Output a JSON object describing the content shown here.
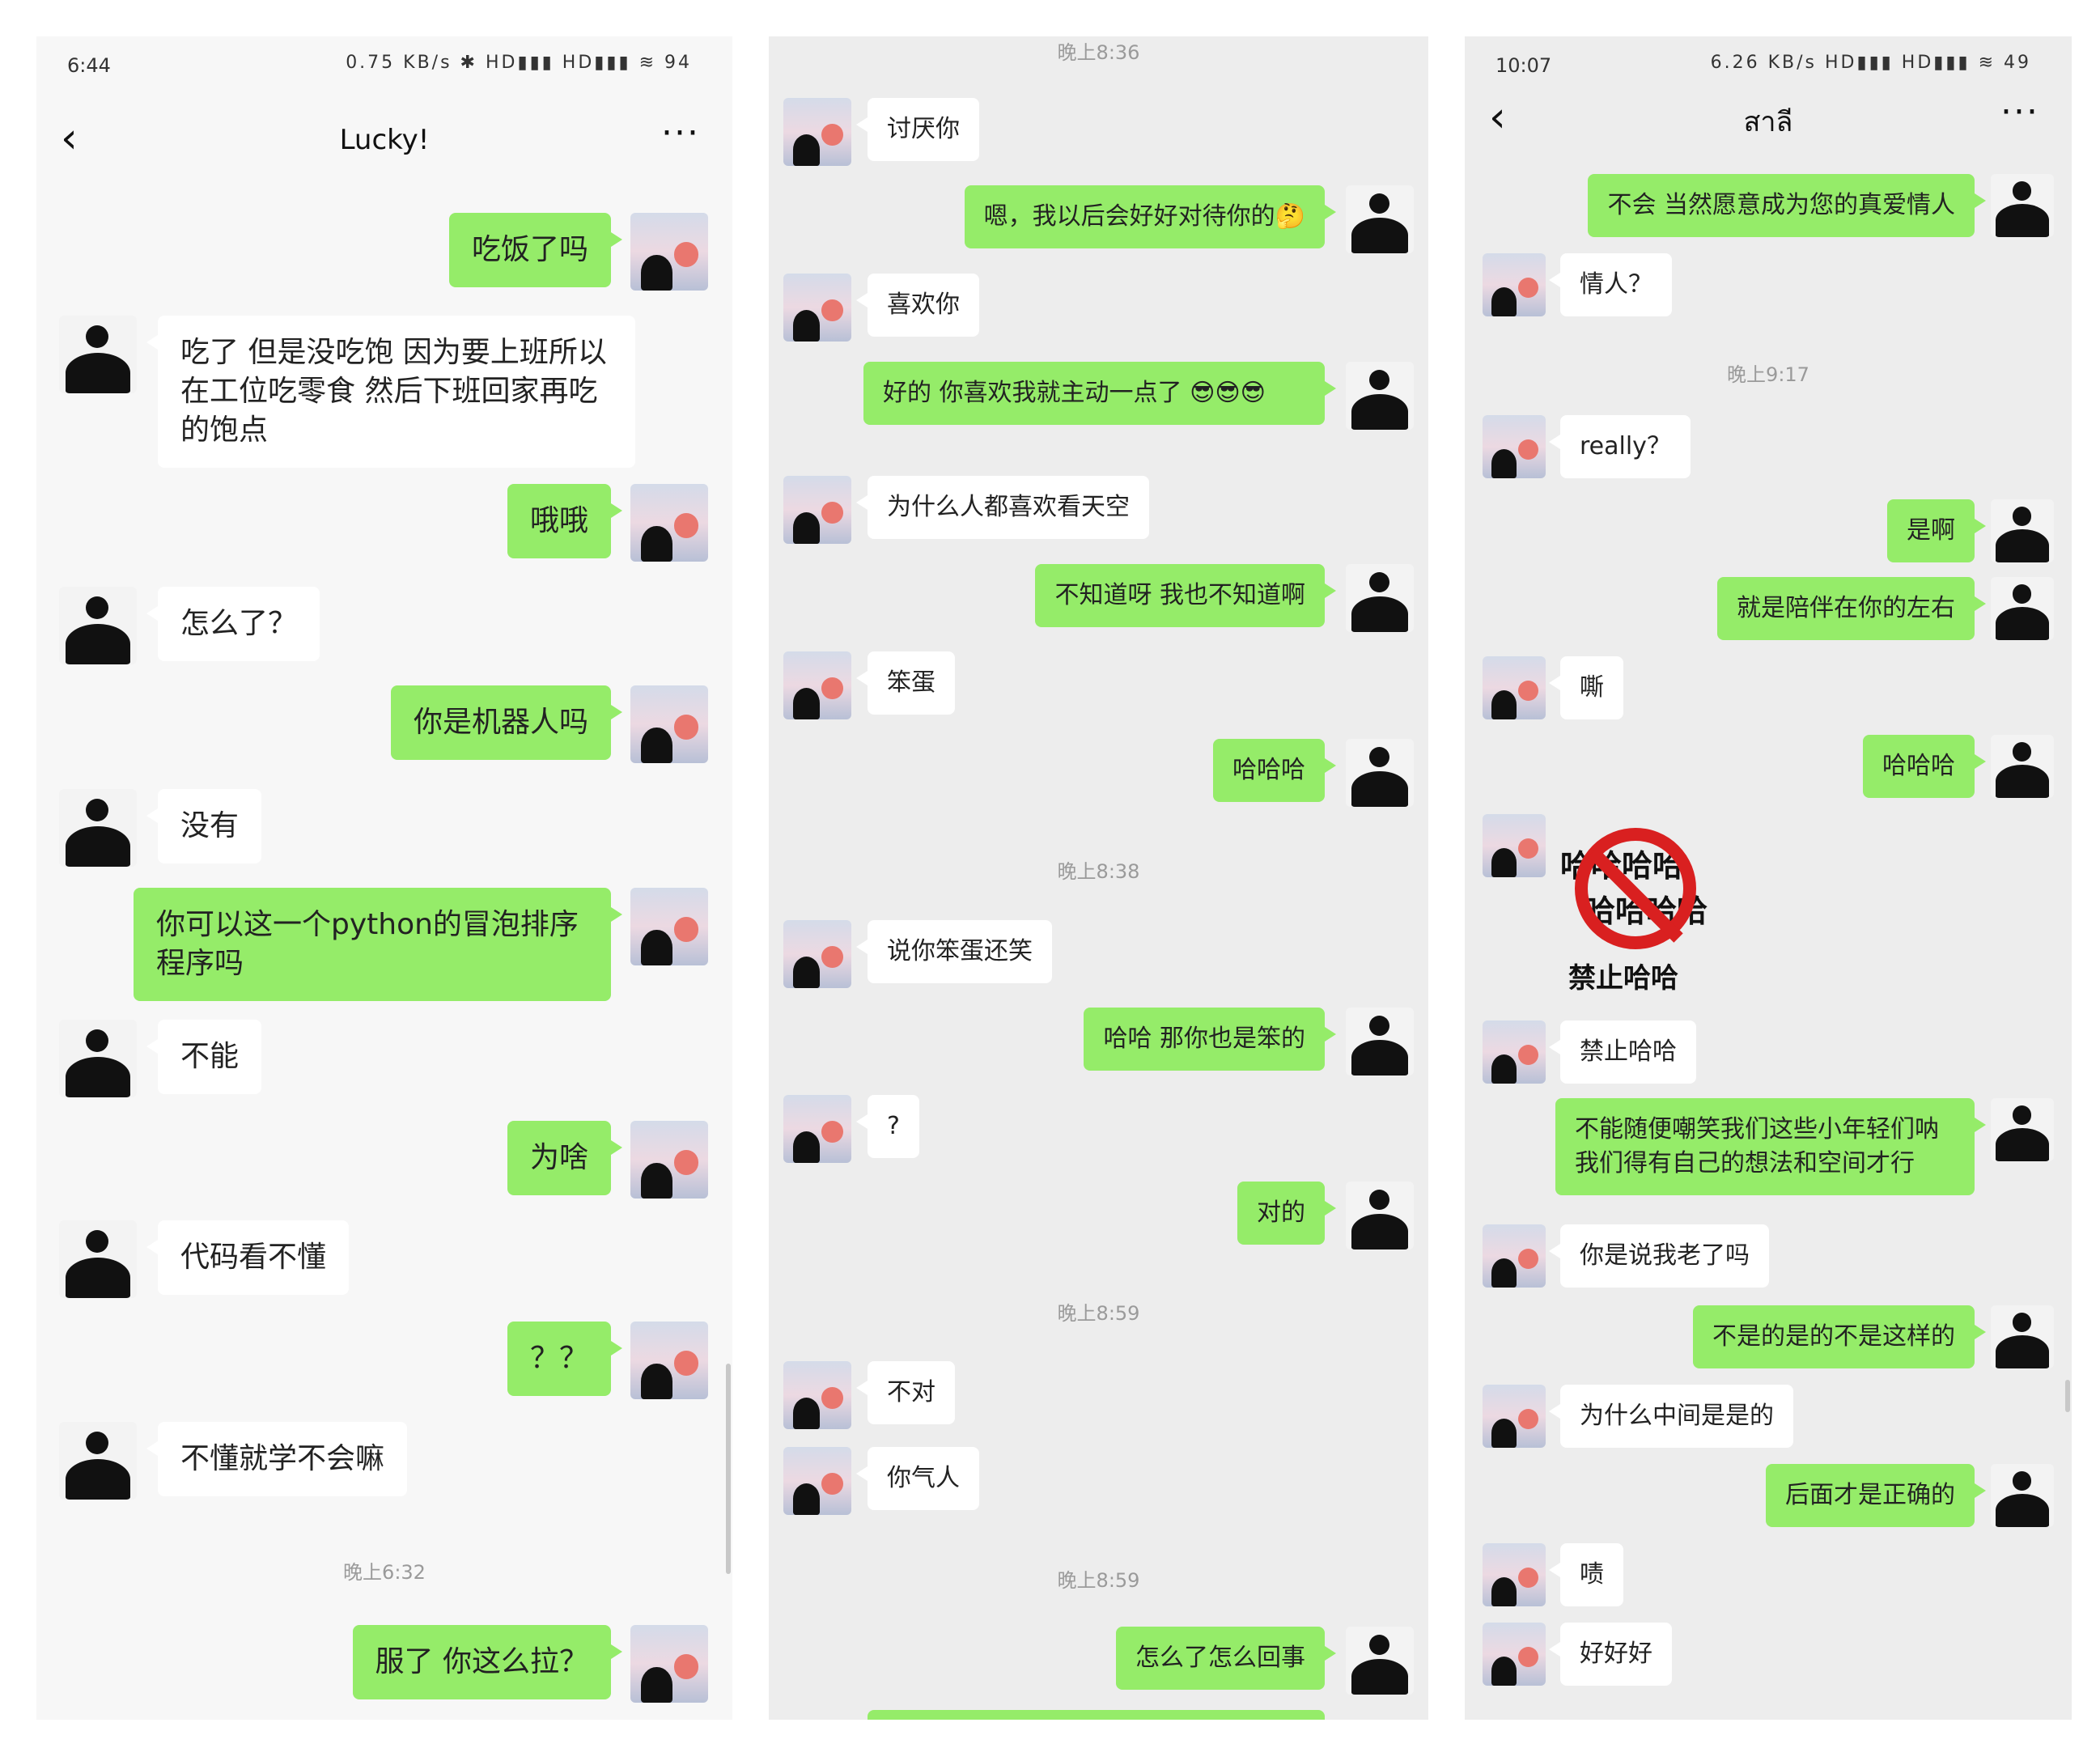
{
  "screen1": {
    "status": {
      "time": "6:44",
      "icons": "0.75 KB/s ✱ HD▮▮▮ HD▮▮▮ ≋ 94"
    },
    "title": "Lucky!",
    "messages": [
      "吃饭了吗",
      "吃了 但是没吃饱 因为要上班所以在工位吃零食 然后下班回家再吃的饱点",
      "哦哦",
      "怎么了？",
      "你是机器人吗",
      "没有",
      "你可以这一个python的冒泡排序程序吗",
      "不能",
      "为啥",
      "代码看不懂",
      "？？",
      "不懂就学不会嘛",
      "服了 你这么拉？"
    ],
    "timestamp": "晚上6:32"
  },
  "screen2": {
    "timestamps": [
      "晚上8:36",
      "晚上8:38",
      "晚上8:59",
      "晚上8:59"
    ],
    "messages": [
      "讨厌你",
      "嗯，我以后会好好对待你的🤔",
      "喜欢你",
      "好的 你喜欢我就主动一点了 😎😎😎",
      "为什么人都喜欢看天空",
      "不知道呀 我也不知道啊",
      "笨蛋",
      "哈哈哈",
      "说你笨蛋还笑",
      "哈哈 那你也是笨的",
      "?",
      "对的",
      "不对",
      "你气人",
      "怎么了怎么回事"
    ]
  },
  "screen3": {
    "status": {
      "time": "10:07",
      "icons": "6.26 KB/s HD▮▮▮ HD▮▮▮ ≋ 49"
    },
    "title": "สาลี",
    "timestamp": "晚上9:17",
    "sticker": {
      "line1": "哈哈哈哈",
      "line2": "哈哈哈哈",
      "caption": "禁止哈哈"
    },
    "messages": [
      "不会 当然愿意成为您的真爱情人",
      "情人？",
      "really？",
      "是啊",
      "就是陪伴在你的左右",
      "嘶",
      "哈哈哈",
      "禁止哈哈",
      "不能随便嘲笑我们这些小年轻们呐 我们得有自己的想法和空间才行",
      "你是说我老了吗",
      "不是的是的不是这样的",
      "为什么中间是是的",
      "后面才是正确的",
      "啧",
      "好好好"
    ]
  },
  "icons": {
    "back": "chevron-left-icon",
    "more": "more-dots-icon"
  }
}
